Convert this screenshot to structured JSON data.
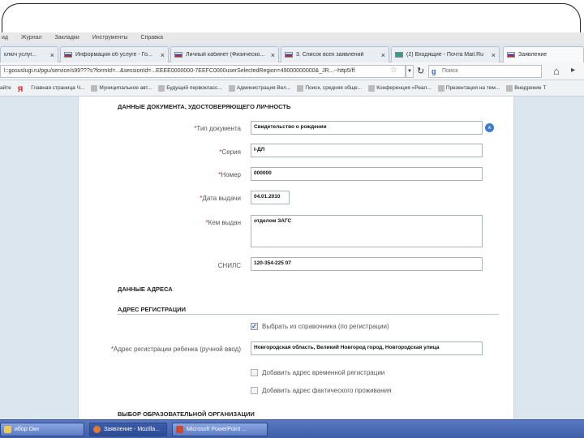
{
  "menubar": [
    "ид",
    "Журнал",
    "Закладки",
    "Инструменты",
    "Справка"
  ],
  "tabs": [
    {
      "title": "ключ услуг...",
      "active": false,
      "flag": "none"
    },
    {
      "title": "Информация об услуге - Го...",
      "active": false,
      "flag": "ru"
    },
    {
      "title": "Личный кабинет (Физическо...",
      "active": false,
      "flag": "ru"
    },
    {
      "title": "3. Список всех заявлений",
      "active": false,
      "flag": "ru"
    },
    {
      "title": "(2) Входящие - Почта Mail.Ru",
      "active": false,
      "flag": "teal"
    },
    {
      "title": "Заявление",
      "active": true,
      "flag": "ru"
    }
  ],
  "tab_close_glyph": "×",
  "newtab_glyph": "+",
  "navbar": {
    "url": "l:\\ygosuslugi.ru/fed.ws/.../Lifer...?d=f4a...",
    "url_display": "l::gosuslugi.ru/pgu/service/s99???s?formId=...&sessionId=...EEEE0000000-7EEFC0000userSelectedRegion=49000000000&_JR...--http5/ff",
    "search_placeholder": "Поиск",
    "search_engine_glyph": "g"
  },
  "bookmarks": [
    {
      "label": "айте",
      "icon": "none"
    },
    {
      "label": "Я",
      "icon": "yandex"
    },
    {
      "label": "Главная страница Ч...",
      "icon": "none"
    },
    {
      "label": "Муниципальное авт...",
      "icon": "default"
    },
    {
      "label": "Будущий первокласс...",
      "icon": "default"
    },
    {
      "label": "Администрация Вел...",
      "icon": "default"
    },
    {
      "label": "Поиск, средняя обще...",
      "icon": "default"
    },
    {
      "label": "Конференция «Реал...",
      "icon": "default"
    },
    {
      "label": "Презентация на тем...",
      "icon": "default"
    },
    {
      "label": "Внедрение Т",
      "icon": "default"
    }
  ],
  "form": {
    "doc_section": "ДАННЫЕ ДОКУМЕНТА, УДОСТОВЕРЯЮЩЕГО ЛИЧНОСТЬ",
    "fields": [
      {
        "label": "Тип документа",
        "required": true,
        "value": "Свидетельство о рождении"
      },
      {
        "label": "Серия",
        "required": true,
        "value": "I-ДЛ"
      },
      {
        "label": "Номер",
        "required": true,
        "value": "000000"
      },
      {
        "label": "Дата выдачи",
        "required": true,
        "value": "04.01.2010"
      },
      {
        "label": "Кем выдан",
        "required": true,
        "value": "отделом ЗАГС"
      },
      {
        "label": "СНИЛС",
        "required": false,
        "value": "120-354-225 07"
      }
    ],
    "address_header": "ДАННЫЕ АДРЕСА",
    "registration_section": "АДРЕС РЕГИСТРАЦИИ",
    "checkbox_registration": "Выбрать из справочника (по регистрации)",
    "address_label": "Адрес регистрации ребенка (ручной ввод)",
    "address_required": true,
    "address_value": "Новгородская область, Великий Новгород город, Новгородская улица",
    "checkbox_temporary": "Добавить адрес временной регистрации",
    "checkbox_actual": "Добавить адрес фактического проживания",
    "org_section": "ВЫБОР ОБРАЗОВАТЕЛЬНОЙ ОРГАНИЗАЦИИ",
    "required_mark": "*"
  },
  "taskbar": [
    {
      "label": "ибор Окн",
      "active": false
    },
    {
      "label": "Заявление - Mozilla...",
      "active": true
    },
    {
      "label": "Microsoft PowerPoint ...",
      "active": false
    }
  ],
  "colors": {
    "accent": "#3b7ad1",
    "required": "#d22222",
    "page_bg": "#dce6ef",
    "taskbar": "#3e5ea8"
  }
}
